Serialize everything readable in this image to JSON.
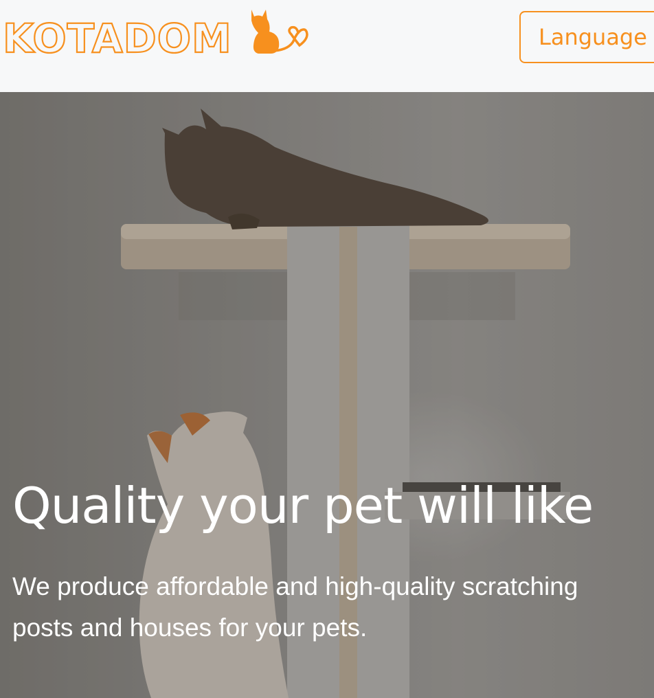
{
  "header": {
    "logo_text": "KOTADOM",
    "language_label": "Language"
  },
  "hero": {
    "headline": "Quality your pet will like",
    "subtext": "We produce affordable and high-quality scratching posts and houses for your pets."
  },
  "colors": {
    "brand_orange": "#f7901e",
    "header_bg": "#f7f8f9",
    "hero_text": "#ffffff"
  },
  "icons": [
    "cat-heart-logo-icon"
  ]
}
